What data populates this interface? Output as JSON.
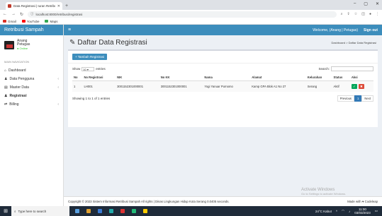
{
  "browser": {
    "tab_title": "Data Registrasi | Iuran Retribusi / Sa",
    "url": "localhost:8000/retribusi/registrasi",
    "bookmarks": [
      "Gmail",
      "YouTube",
      "Maps"
    ]
  },
  "sidebar": {
    "brand": "Retribusi Sampah",
    "user_name": "Anang",
    "user_role": "Petugas",
    "user_status": "● Online",
    "nav_header": "MAIN NAVIGATION",
    "items": [
      {
        "icon": "⌂",
        "label": "Dashboard"
      },
      {
        "icon": "♟",
        "label": "Data Pengguna"
      },
      {
        "icon": "▤",
        "label": "Master Data"
      },
      {
        "icon": "♟",
        "label": "Registrasi"
      },
      {
        "icon": "⇄",
        "label": "Billing"
      }
    ]
  },
  "topbar": {
    "welcome": "Welcome, (Anang | Petugas)",
    "signout": "Sign out"
  },
  "page": {
    "title": "Daftar Data Registrasi",
    "breadcrumb": "Dashboard > Daftar Data Registrasi",
    "add_button": "+ Tambah Registrasi",
    "show": "Show",
    "entries": "entries",
    "entries_value": "10",
    "search": "Search:"
  },
  "table": {
    "headers": [
      "No",
      "No Registrasi",
      "NIK",
      "No KK",
      "Nama",
      "Alamat",
      "Kelurahan",
      "Status",
      "Aksi"
    ],
    "rows": [
      {
        "no": "1",
        "noreg": "LH001",
        "nik": "3001152301000001",
        "nokk": "3001152301000001",
        "nama": "Yogi Yanuar Purnomo",
        "alamat": "Kamp GPA Blok A1 No 27",
        "kelurahan": "Serang",
        "status": "Aktif"
      }
    ]
  },
  "footer_info": {
    "showing": "Showing 1 to 1 of 1 entries",
    "prev": "Previous",
    "page": "1",
    "next": "Next"
  },
  "footer": {
    "copyright": "Copyright © 2023 Sistem Informasi Retribusi Sampah All rights | Dinas Lingkungan Hidup Kota Serang 0.0405 seconds.",
    "made": "Made with ♥ Codeleap"
  },
  "watermark": {
    "title": "Activate Windows",
    "sub": "Go to Settings to activate Windows."
  },
  "taskbar": {
    "search": "Type here to search",
    "weather": "24°C Kabut",
    "time": "11:00",
    "date": "03/03/2023"
  }
}
